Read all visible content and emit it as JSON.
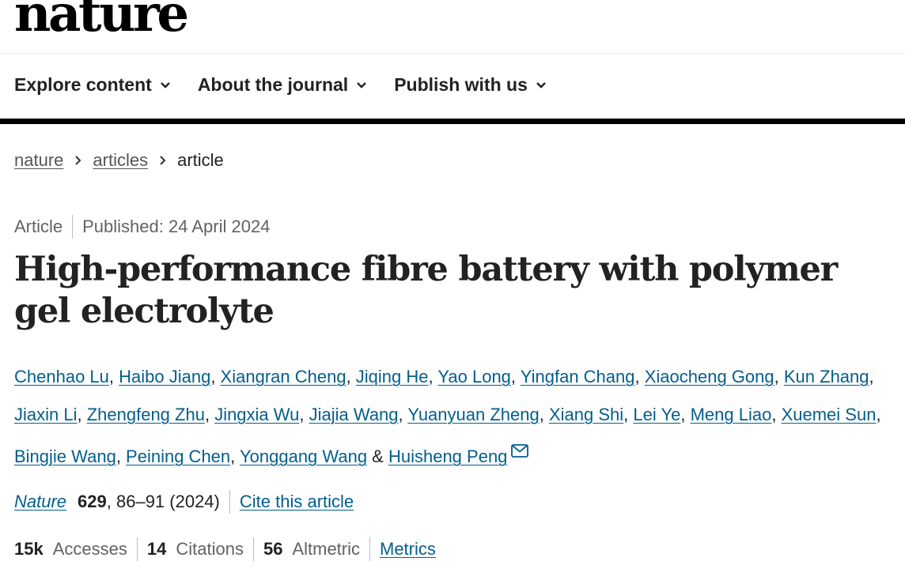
{
  "header": {
    "logo_text": "nature",
    "nav": [
      {
        "label": "Explore content"
      },
      {
        "label": "About the journal"
      },
      {
        "label": "Publish with us"
      }
    ]
  },
  "breadcrumb": {
    "items": [
      "nature",
      "articles"
    ],
    "current": "article"
  },
  "article": {
    "type": "Article",
    "published": "Published: 24 April 2024",
    "title": "High-performance fibre battery with polymer gel electrolyte",
    "authors": [
      "Chenhao Lu",
      "Haibo Jiang",
      "Xiangran Cheng",
      "Jiqing He",
      "Yao Long",
      "Yingfan Chang",
      "Xiaocheng Gong",
      "Kun Zhang",
      "Jiaxin Li",
      "Zhengfeng Zhu",
      "Jingxia Wu",
      "Jiajia Wang",
      "Yuanyuan Zheng",
      "Xiang Shi",
      "Lei Ye",
      "Meng Liao",
      "Xuemei Sun",
      "Bingjie Wang",
      "Peining Chen",
      "Yonggang Wang",
      "Huisheng Peng"
    ],
    "author_separator": ", ",
    "last_author_separator": " & ",
    "corresponding_icon": "envelope-icon"
  },
  "citation": {
    "journal": "Nature",
    "volume": "629",
    "pages_year": ", 86–91 (2024)",
    "cite_label": "Cite this article"
  },
  "metrics": {
    "accesses_value": "15k",
    "accesses_label": "Accesses",
    "citations_value": "14",
    "citations_label": "Citations",
    "altmetric_value": "56",
    "altmetric_label": "Altmetric",
    "metrics_link": "Metrics"
  },
  "colors": {
    "link": "#025e8d",
    "text": "#222222",
    "muted": "#626262",
    "header_bar": "#000000"
  }
}
